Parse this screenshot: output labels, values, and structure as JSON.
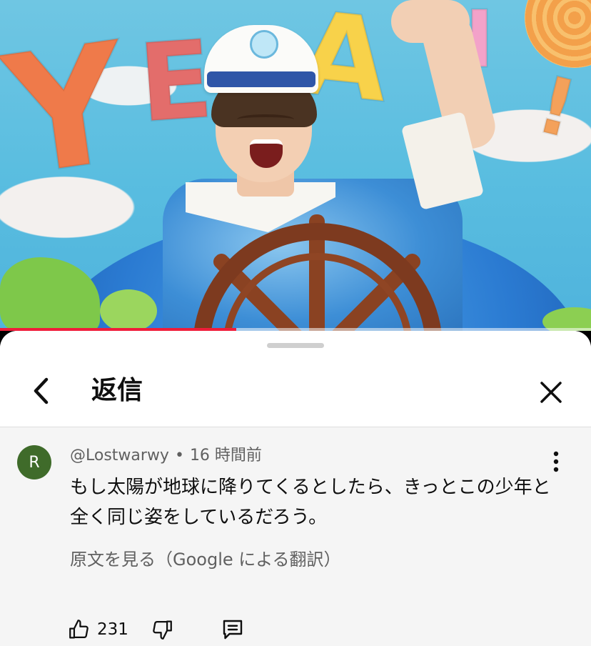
{
  "video": {
    "progress": 0.4,
    "progress_color": "#f01d3a"
  },
  "sheet": {
    "title": "返信",
    "back_icon": "chevron-left-icon",
    "close_icon": "close-icon"
  },
  "comment": {
    "avatar_letter": "R",
    "avatar_color": "#3f6b2a",
    "author": "@Lostwarwy",
    "separator": "•",
    "time": "16 時間前",
    "text": "もし太陽が地球に降りてくるとしたら、きっとこの少年と全く同じ姿をしているだろう。",
    "translate_link": "原文を見る（Google による翻訳）",
    "like_count": "231"
  },
  "icons": {
    "like": "thumbs-up-icon",
    "dislike": "thumbs-down-icon",
    "reply": "comment-icon",
    "more": "more-vertical-icon"
  }
}
